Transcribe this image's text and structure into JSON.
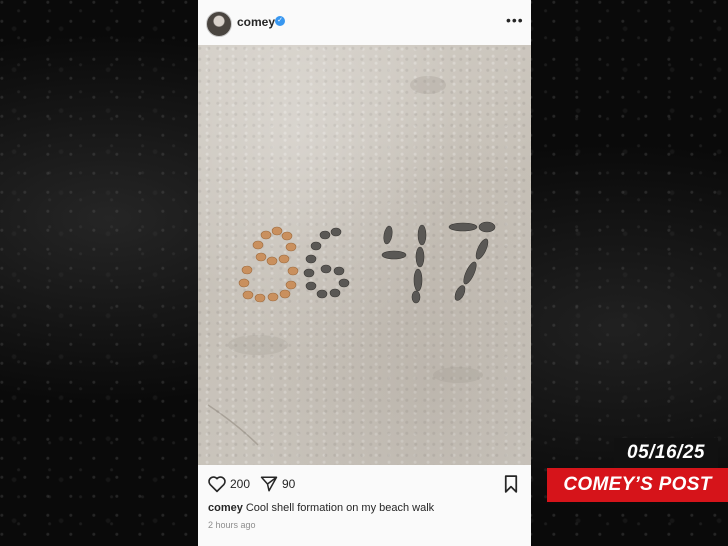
{
  "post": {
    "username": "comey",
    "verified": true,
    "more_icon": "more-horizontal-icon",
    "photo_text": "8647",
    "likes": "200",
    "shares": "90",
    "caption_user": "comey",
    "caption_text": "Cool shell formation on my beach walk",
    "timestamp": "2 hours ago"
  },
  "overlay": {
    "date": "05/16/25",
    "title": "COMEY’S POST",
    "title_color": "#d6141a"
  }
}
